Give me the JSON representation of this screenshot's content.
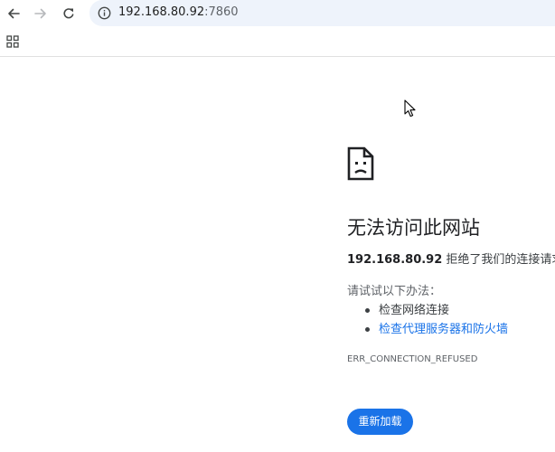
{
  "browser": {
    "address": {
      "host": "192.168.80.92",
      "port": ":7860"
    }
  },
  "error": {
    "title": "无法访问此网站",
    "host": "192.168.80.92",
    "summary_rest": " 拒绝了我们的连接请求。",
    "suggest_label": "请试试以下办法：",
    "tips": [
      {
        "label": "检查网络连接",
        "link": false
      },
      {
        "label": "检查代理服务器和防火墙",
        "link": true
      }
    ],
    "code": "ERR_CONNECTION_REFUSED",
    "reload_label": "重新加载"
  },
  "colors": {
    "accent": "#1a73e8",
    "omnibox_bg": "#eef3fb",
    "text": "#202124",
    "secondary_text": "#5f6368"
  },
  "icons": {
    "back": "arrow-left-icon",
    "forward": "arrow-right-icon",
    "reload": "reload-icon",
    "site_info": "info-icon",
    "apps": "apps-grid-icon",
    "error": "sad-document-icon",
    "cursor": "mouse-cursor-icon"
  }
}
